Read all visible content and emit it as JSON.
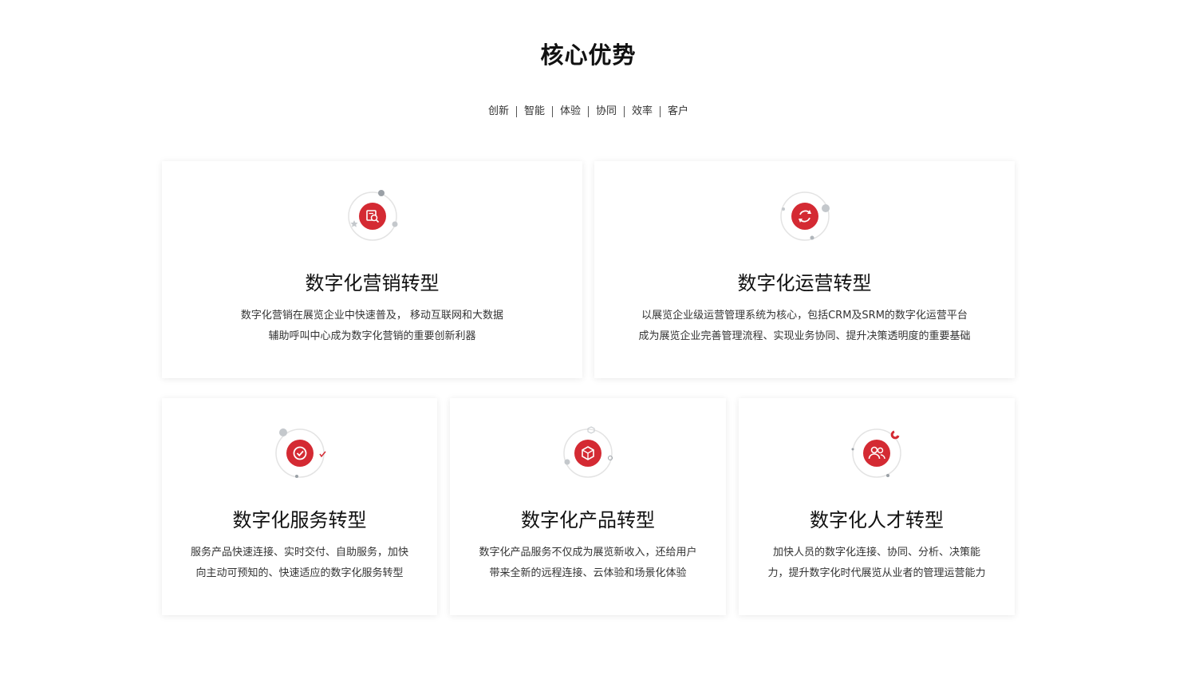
{
  "section": {
    "title": "核心优势",
    "keywords": [
      "创新",
      "智能",
      "体验",
      "协同",
      "效率",
      "客户"
    ]
  },
  "colors": {
    "accent": "#d42a33",
    "ring": "#e3e3e3",
    "dot_grey": "#b9bec3"
  },
  "cards": [
    {
      "icon": "marketing-icon",
      "title": "数字化营销转型",
      "desc_lines": [
        "数字化营销在展览企业中快速普及， 移动互联网和大数据",
        "辅助呼叫中心成为数字化营销的重要创新利器"
      ]
    },
    {
      "icon": "operation-icon",
      "title": "数字化运营转型",
      "desc_lines": [
        "以展览企业级运营管理系统为核心，包括CRM及SRM的数字化运营平台",
        "成为展览企业完善管理流程、实现业务协同、提升决策透明度的重要基础"
      ]
    },
    {
      "icon": "service-icon",
      "title": "数字化服务转型",
      "desc_lines": [
        "服务产品快速连接、实时交付、自助服务，加快",
        "向主动可预知的、快速适应的数字化服务转型"
      ]
    },
    {
      "icon": "product-icon",
      "title": "数字化产品转型",
      "desc_lines": [
        "数字化产品服务不仅成为展览新收入，还给用户",
        "带来全新的远程连接、云体验和场景化体验"
      ]
    },
    {
      "icon": "talent-icon",
      "title": "数字化人才转型",
      "desc_lines": [
        "加快人员的数字化连接、协同、分析、决策能",
        "力，提升数字化时代展览从业者的管理运营能力"
      ]
    }
  ]
}
